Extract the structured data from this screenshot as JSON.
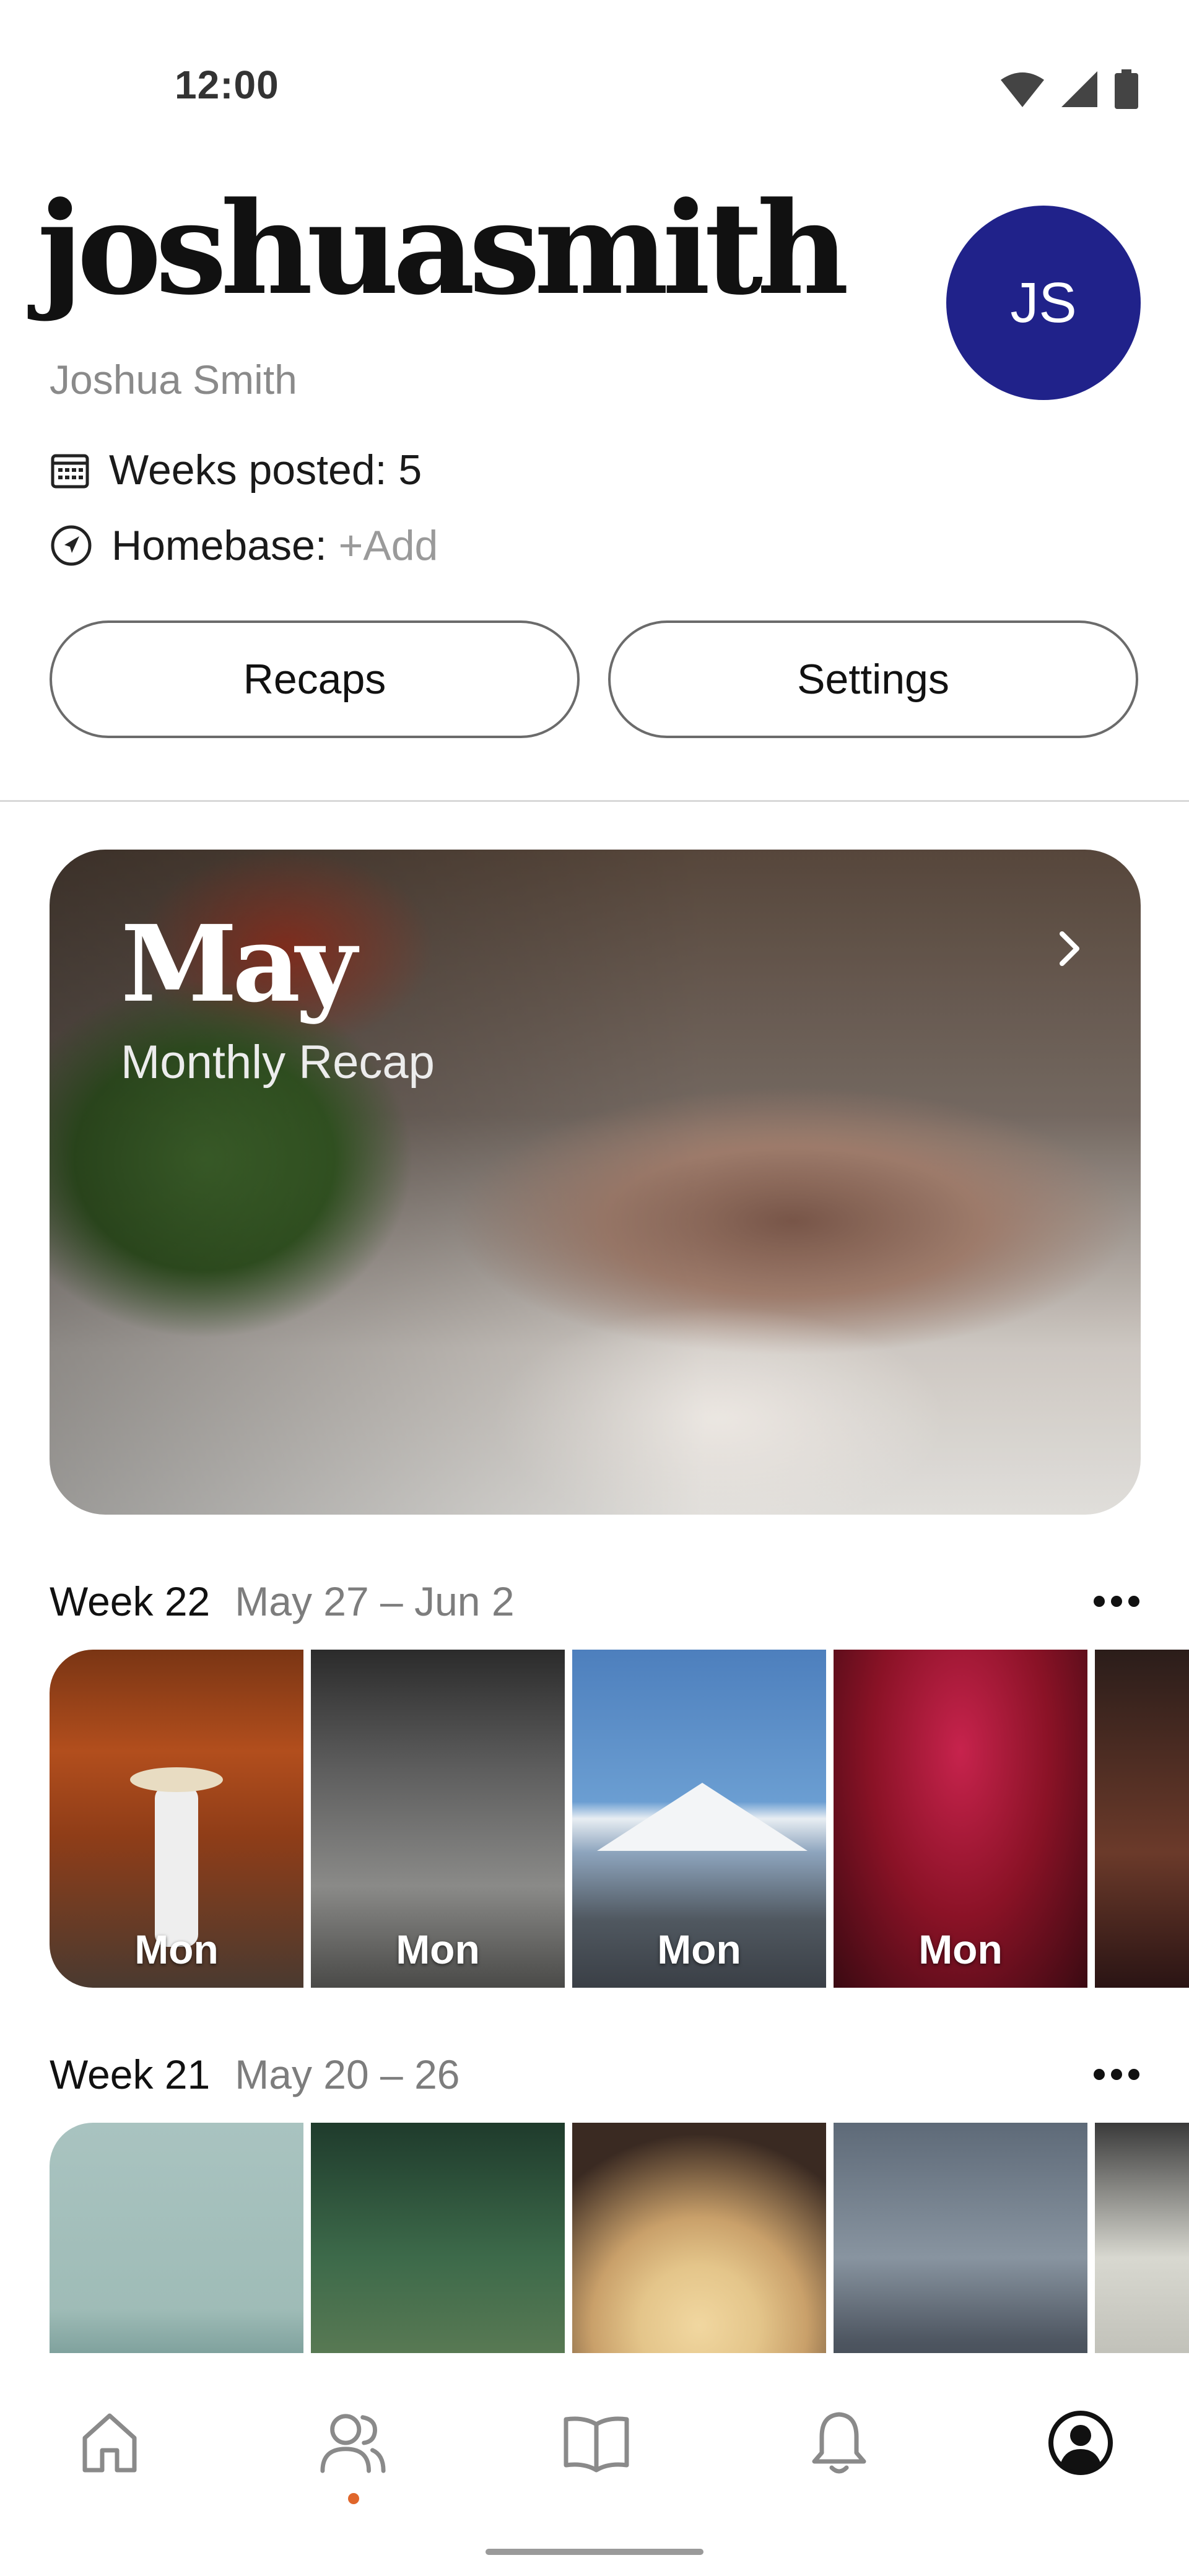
{
  "status_bar": {
    "time": "12:00",
    "icons": [
      "wifi-icon",
      "signal-icon",
      "battery-icon"
    ]
  },
  "profile": {
    "username": "joshuasmith",
    "full_name": "Joshua Smith",
    "avatar_initials": "JS",
    "avatar_color": "#20228a",
    "weeks_posted_label": "Weeks posted: 5",
    "homebase_label": "Homebase:",
    "homebase_action": "+Add"
  },
  "buttons": {
    "recaps": "Recaps",
    "settings": "Settings"
  },
  "recap_card": {
    "month": "May",
    "subtitle": "Monthly Recap"
  },
  "weeks": [
    {
      "title": "Week 22",
      "range": "May 27 – Jun 2",
      "days": [
        "Mon",
        "Mon",
        "Mon",
        "Mon"
      ]
    },
    {
      "title": "Week 21",
      "range": "May 20 – 26"
    }
  ],
  "nav": {
    "items": [
      "home-icon",
      "friends-icon",
      "journal-icon",
      "notifications-icon",
      "profile-icon"
    ],
    "active_index": 4,
    "indicator_color": "#e0662b"
  }
}
